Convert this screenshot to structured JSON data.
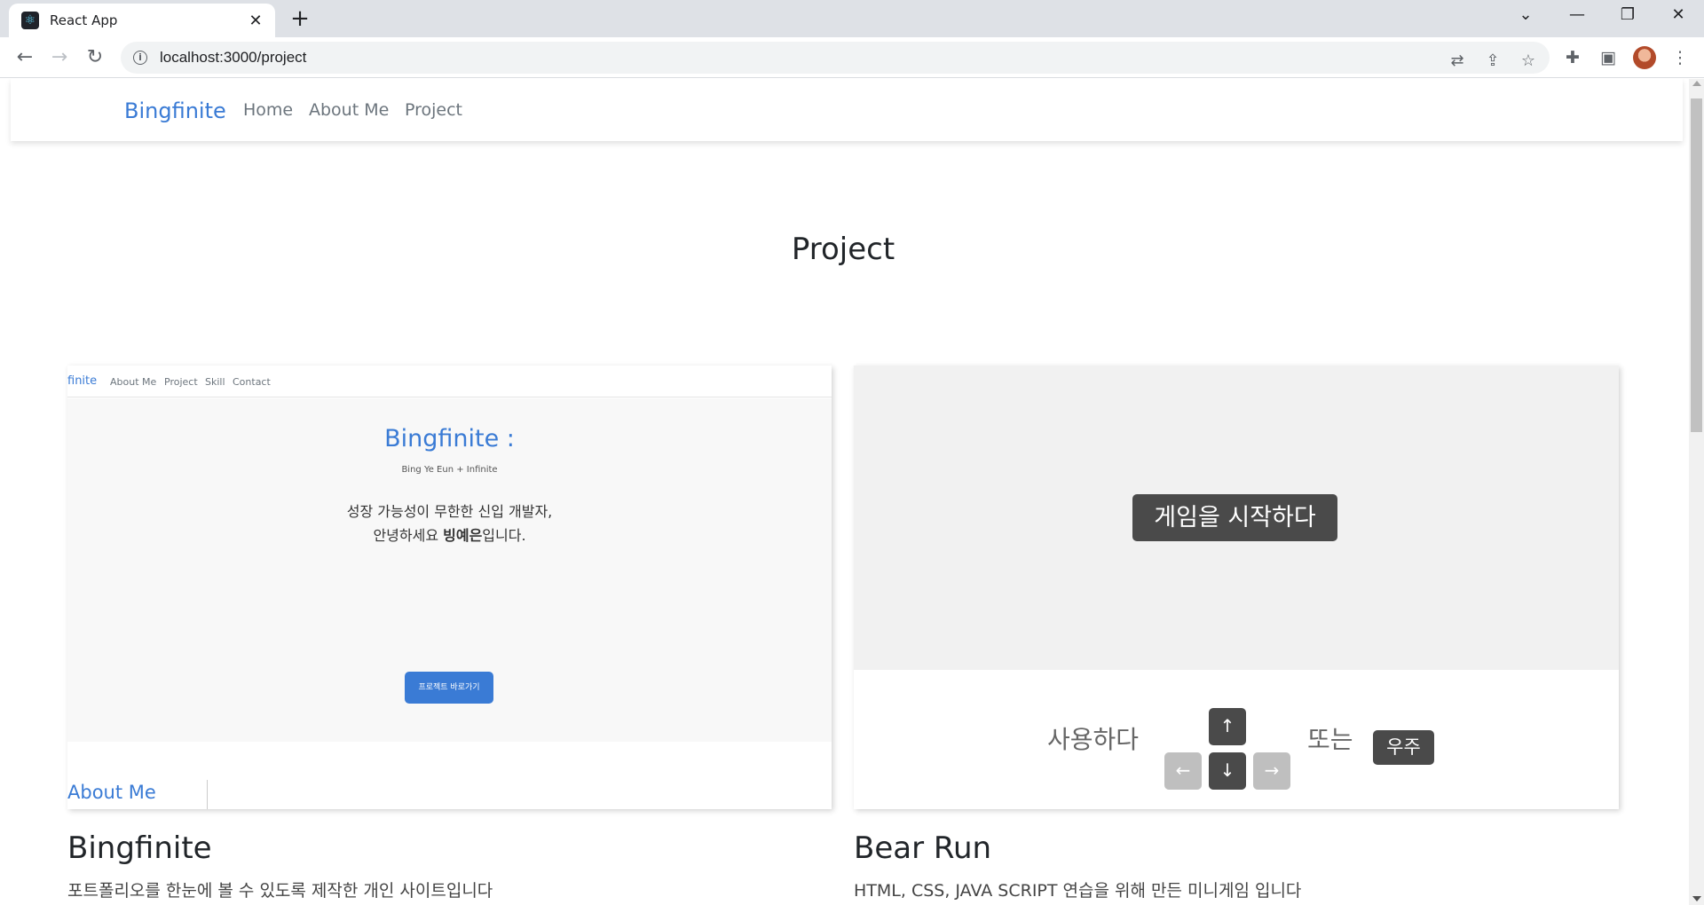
{
  "browser": {
    "tab_title": "React App",
    "url": "localhost:3000/project"
  },
  "site": {
    "brand": "Bingfinite",
    "nav": [
      "Home",
      "About Me",
      "Project"
    ],
    "page_title": "Project"
  },
  "projects": [
    {
      "title": "Bingfinite",
      "description": "포트폴리오를 한눈에 볼 수 있도록 제작한 개인 사이트입니다",
      "preview": {
        "brand": "finite",
        "nav": [
          "About Me",
          "Project",
          "Skill",
          "Contact"
        ],
        "heading": "Bingfinite :",
        "subheading": "Bing Ye Eun + Infinite",
        "line1": "성장 가능성이 무한한 신입 개발자,",
        "line2_prefix": "안녕하세요 ",
        "line2_bold": "빙예은",
        "line2_suffix": "입니다.",
        "button": "프로젝트 바로가기",
        "section": "About Me"
      }
    },
    {
      "title": "Bear Run",
      "description": "HTML, CSS, JAVA SCRIPT 연습을 위해 만든 미니게임 입니다",
      "preview": {
        "start_button": "게임을 시작하다",
        "use_label": "사용하다",
        "or_label": "또는",
        "space_key": "우주",
        "keys": {
          "up": "↑",
          "left": "←",
          "down": "↓",
          "right": "→"
        }
      }
    }
  ],
  "colors": {
    "accent": "#3a7bd5",
    "key_dark": "#4a4a4a",
    "key_light": "#bfbfbf"
  }
}
